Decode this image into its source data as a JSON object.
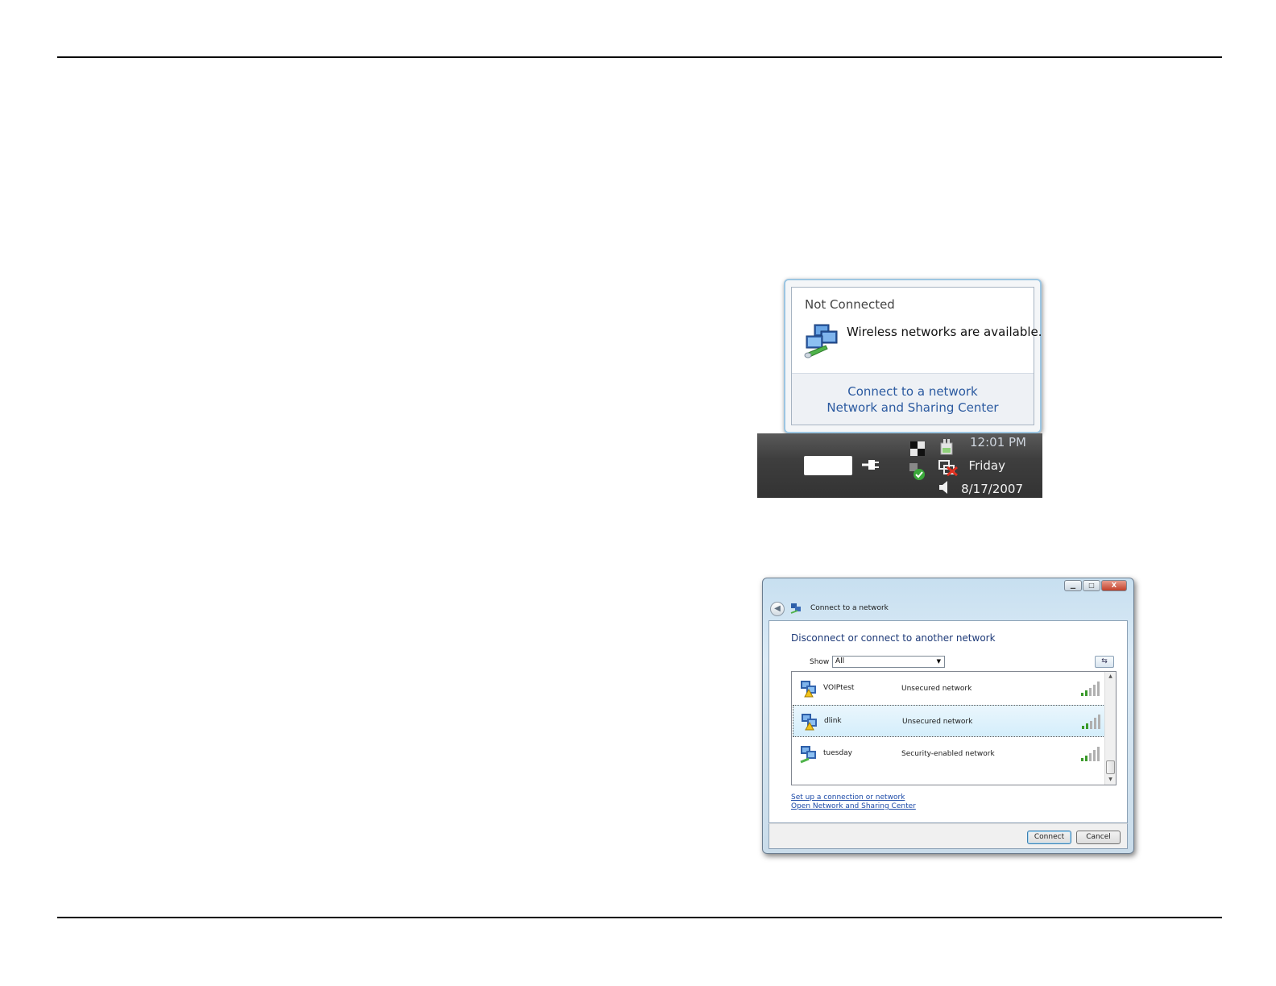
{
  "balloon": {
    "title": "Not Connected",
    "message": "Wireless networks are available.",
    "links": [
      "Connect to a network",
      "Network and Sharing Center"
    ]
  },
  "taskbar": {
    "time": "12:01 PM",
    "day": "Friday",
    "date": "8/17/2007",
    "icons": [
      "battery-icon",
      "plug-icon",
      "checker-icon",
      "shield-icon",
      "power-icon",
      "network-disconnected-icon",
      "volume-icon"
    ]
  },
  "dialog": {
    "window_title": "Connect to a network",
    "heading": "Disconnect or connect to another network",
    "show_label": "Show",
    "show_value": "All",
    "networks": [
      {
        "name": "VOIPtest",
        "security": "Unsecured network",
        "signal_bars": 5
      },
      {
        "name": "dlink",
        "security": "Unsecured network",
        "signal_bars": 5,
        "selected": true
      },
      {
        "name": "tuesday",
        "security": "Security-enabled network",
        "signal_bars": 5
      }
    ],
    "links": [
      "Set up a connection or network",
      "Open Network and Sharing Center"
    ],
    "buttons": {
      "connect": "Connect",
      "cancel": "Cancel"
    },
    "window_buttons": {
      "minimize": "▁",
      "maximize": "□",
      "close": "X"
    }
  },
  "colors": {
    "link_blue": "#2b5aa0",
    "heading_blue": "#1e3a78",
    "taskbar_dark": "#3e3e3e",
    "selected_row": "#d4eefb",
    "signal_green": "#3a9a2a"
  }
}
